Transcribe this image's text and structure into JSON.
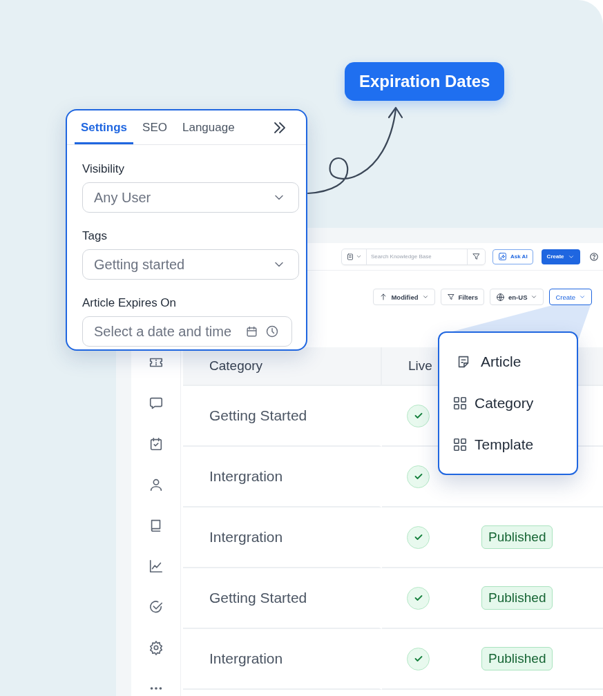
{
  "callout": {
    "label": "Expiration Dates"
  },
  "settings_card": {
    "tabs": [
      {
        "label": "Settings",
        "selected": true
      },
      {
        "label": "SEO",
        "selected": false
      },
      {
        "label": "Language",
        "selected": false
      }
    ],
    "fields": [
      {
        "label": "Visibility",
        "kind": "select",
        "value": "Any User"
      },
      {
        "label": "Tags",
        "kind": "select",
        "value": "Getting started"
      },
      {
        "label": "Article Expires On",
        "kind": "datetime",
        "placeholder": "Select a date and time"
      }
    ]
  },
  "app": {
    "header": {
      "search_placeholder": "Search Knowledge Base",
      "ask_ai": "Ask AI",
      "create": "Create"
    },
    "toolbar": {
      "sort": "Modified",
      "filters": "Filters",
      "locale": "en-US",
      "create": "Create"
    },
    "table": {
      "columns": [
        "Category",
        "Live"
      ],
      "rows": [
        {
          "category": "Getting Started",
          "live": true
        },
        {
          "category": "Intergration",
          "live": true
        },
        {
          "category": "Intergration",
          "live": true,
          "status": "Published"
        },
        {
          "category": "Getting Started",
          "live": true,
          "status": "Published"
        },
        {
          "category": "Intergration",
          "live": true,
          "status": "Published"
        }
      ]
    }
  },
  "create_menu": {
    "items": [
      {
        "label": "Article",
        "kind": "article"
      },
      {
        "label": "Category",
        "kind": "grid"
      },
      {
        "label": "Template",
        "kind": "grid"
      }
    ]
  }
}
